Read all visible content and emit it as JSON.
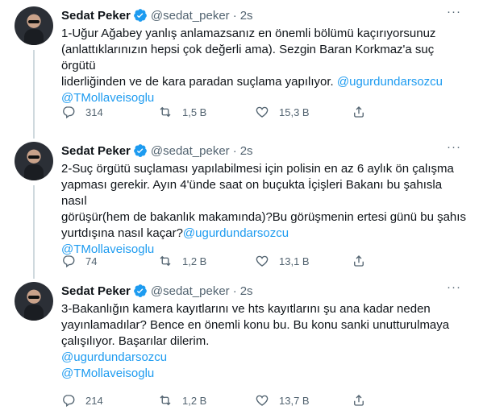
{
  "colors": {
    "accent": "#1d9bf0",
    "text": "#0f1419",
    "muted": "#536471"
  },
  "tweets": [
    {
      "name": "Sedat Peker",
      "handle": "@sedat_peker",
      "separator": "·",
      "time": "2s",
      "more": "···",
      "lines": [
        "1-Uğur Ağabey yanlış anlamazsanız en önemli bölümü kaçırıyorsunuz",
        "(anlattıklarınızın hepsi çok değerli ama). Sezgin Baran Korkmaz'a suç örgütü",
        "liderliğinden ve de kara paradan suçlama yapılıyor. "
      ],
      "mention1": "@ugurdundarsozcu",
      "mention2": "@TMollaveisoglu",
      "replies": "314",
      "retweets": "1,5 B",
      "likes": "15,3 B"
    },
    {
      "name": "Sedat Peker",
      "handle": "@sedat_peker",
      "separator": "·",
      "time": "2s",
      "more": "···",
      "lines": [
        "2-Suç örgütü suçlaması yapılabilmesi için polisin en az 6 aylık ön çalışma",
        "yapması gerekir. Ayın 4'ünde saat on buçukta İçişleri Bakanı bu şahısla nasıl",
        "görüşür(hem de bakanlık makamında)?Bu görüşmenin ertesi günü bu şahıs",
        "yurtdışına nasıl kaçar?"
      ],
      "mention1": "@ugurdundarsozcu",
      "mention2": "@TMollaveisoglu",
      "replies": "74",
      "retweets": "1,2 B",
      "likes": "13,1 B"
    },
    {
      "name": "Sedat Peker",
      "handle": "@sedat_peker",
      "separator": "·",
      "time": "2s",
      "more": "···",
      "lines": [
        "3-Bakanlığın kamera kayıtlarını ve hts kayıtlarını şu ana kadar neden",
        "yayınlamadılar? Bence en önemli konu bu. Bu konu sanki unutturulmaya",
        "çalışılıyor. Başarılar dilerim."
      ],
      "mention1": "@ugurdundarsozcu",
      "mention2": "@TMollaveisoglu",
      "replies": "214",
      "retweets": "1,2 B",
      "likes": "13,7 B"
    }
  ],
  "icons": {
    "verified": "verified-badge-icon",
    "reply": "reply-icon",
    "retweet": "retweet-icon",
    "like": "heart-icon",
    "share": "share-icon",
    "more": "more-options-icon"
  }
}
